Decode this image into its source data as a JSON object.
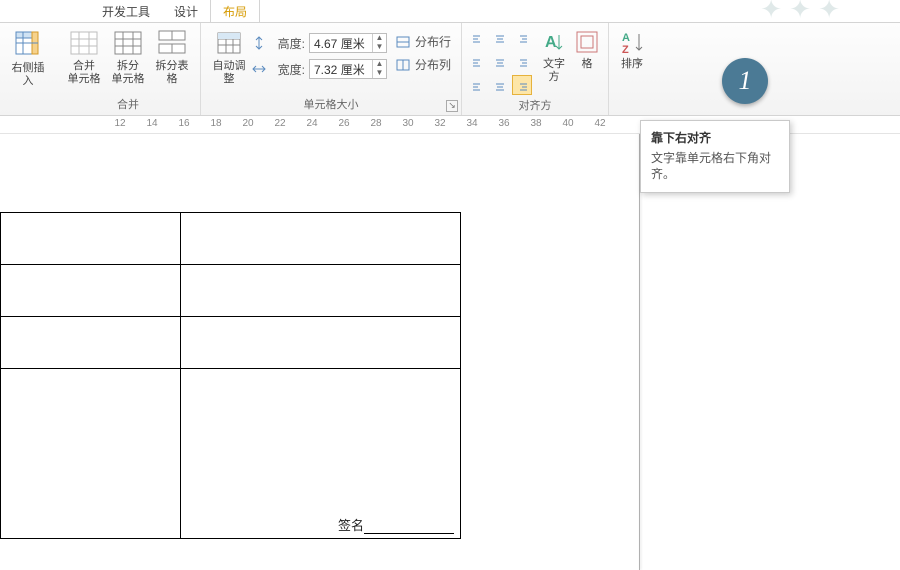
{
  "tabs": {
    "dev": "开发工具",
    "design": "设计",
    "layout": "布局"
  },
  "ribbon": {
    "insert_right": "右侧插入",
    "merge_cells": "合并\n单元格",
    "split_cells": "拆分\n单元格",
    "split_table": "拆分表格",
    "merge_group": "合并",
    "autofit": "自动调整",
    "height_label": "高度:",
    "height_value": "4.67 厘米",
    "width_label": "宽度:",
    "width_value": "7.32 厘米",
    "dist_rows": "分布行",
    "dist_cols": "分布列",
    "cellsize_group": "单元格大小",
    "text_dir": "文字方",
    "cell_margins": "格",
    "align_group": "对齐方",
    "sort": "排序"
  },
  "ruler": {
    "marks": [
      12,
      14,
      16,
      18,
      20,
      22,
      24,
      26,
      28,
      30,
      32,
      34,
      36,
      38,
      40,
      42
    ]
  },
  "doc": {
    "signature_label": "签名"
  },
  "tooltip": {
    "title": "靠下右对齐",
    "body": "文字靠单元格右下角对齐。"
  },
  "badge": "1"
}
